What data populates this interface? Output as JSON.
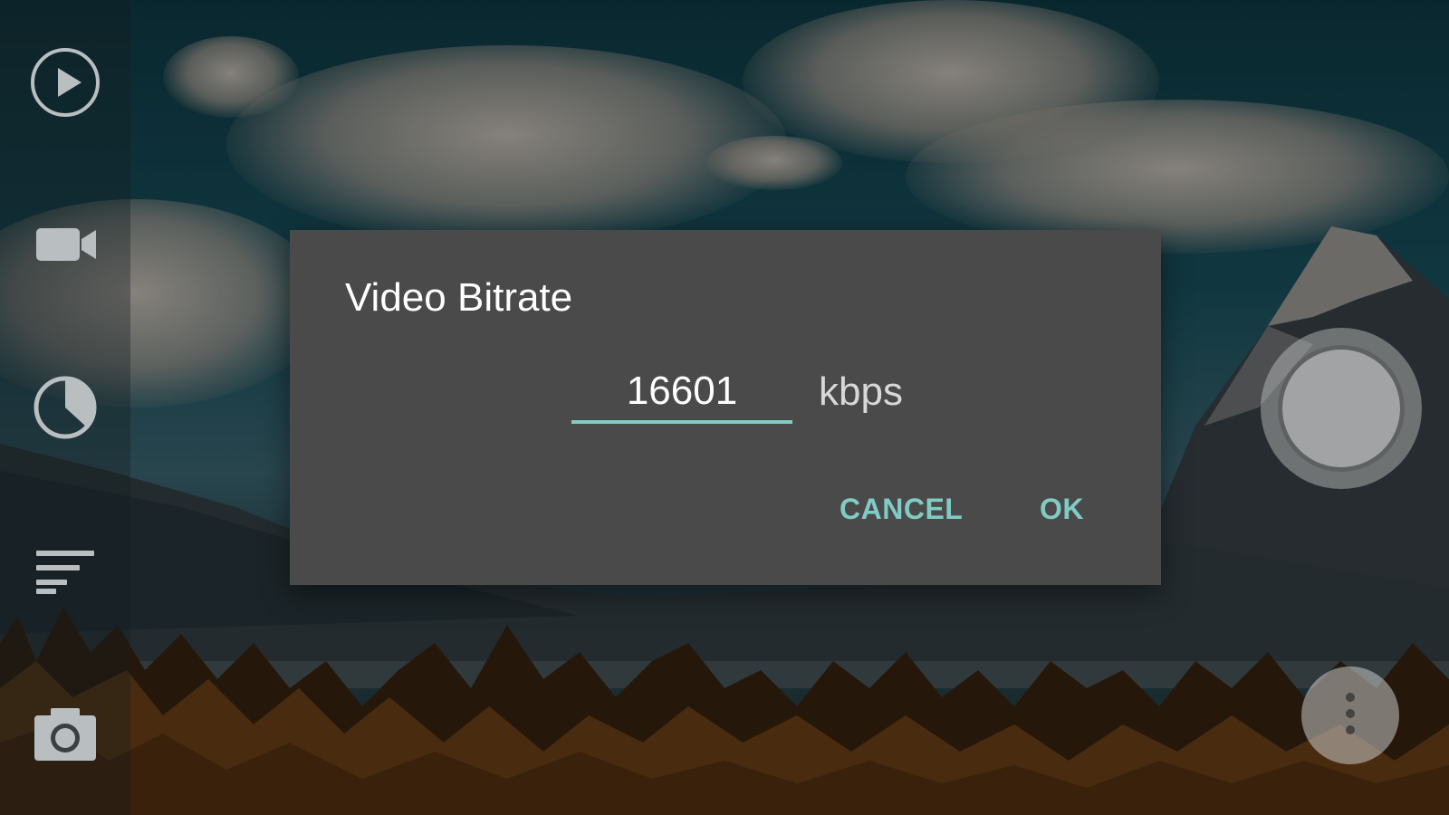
{
  "dialog": {
    "title": "Video Bitrate",
    "bitrate_value": "16601",
    "unit": "kbps",
    "cancel_label": "CANCEL",
    "ok_label": "OK"
  },
  "toolbar": {
    "items": [
      {
        "icon": "play-icon"
      },
      {
        "icon": "video-camera-icon"
      },
      {
        "icon": "timer-icon"
      },
      {
        "icon": "sort-lines-icon"
      },
      {
        "icon": "camera-icon"
      }
    ]
  },
  "controls": {
    "shutter_icon": "shutter-button",
    "more_icon": "more-vert-icon"
  },
  "colors": {
    "accent": "#80cbc4",
    "dialog_background": "#4a4a4a",
    "title_text": "#ffffff"
  }
}
